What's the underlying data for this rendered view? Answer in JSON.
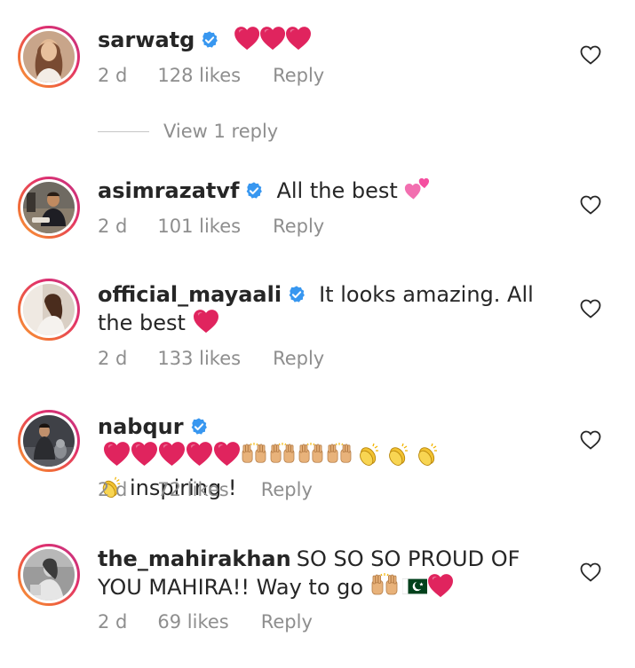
{
  "comments": [
    {
      "username": "sarwatg",
      "verified": true,
      "text": "",
      "time": "2 d",
      "likes": "128 likes",
      "reply": "Reply",
      "view_replies": "View 1 reply"
    },
    {
      "username": "asimrazatvf",
      "verified": true,
      "text": "All the best",
      "time": "2 d",
      "likes": "101 likes",
      "reply": "Reply"
    },
    {
      "username": "official_mayaali",
      "verified": true,
      "text": "It looks amazing. All the best",
      "time": "2 d",
      "likes": "133 likes",
      "reply": "Reply"
    },
    {
      "username": "nabqur",
      "verified": true,
      "text": "inspiring !",
      "time": "2 d",
      "likes": "72 likes",
      "reply": "Reply"
    },
    {
      "username": "the_mahirakhan",
      "verified": false,
      "text": "SO SO SO PROUD OF YOU MAHIRA!! Way to go",
      "time": "2 d",
      "likes": "69 likes",
      "reply": "Reply"
    }
  ],
  "colors": {
    "text": "#262626",
    "muted": "#8e8e8e",
    "verified_blue": "#3897f0",
    "heart_red": "#e0245e"
  },
  "icons": {
    "verified": "verified-badge-icon",
    "like": "heart-outline-icon",
    "emoji_heart": "red-heart-emoji",
    "emoji_pink_hearts": "two-pink-hearts-emoji",
    "emoji_raised_hands": "raising-hands-emoji",
    "emoji_clap": "clapping-hands-emoji",
    "emoji_flag": "pakistan-flag-emoji"
  }
}
